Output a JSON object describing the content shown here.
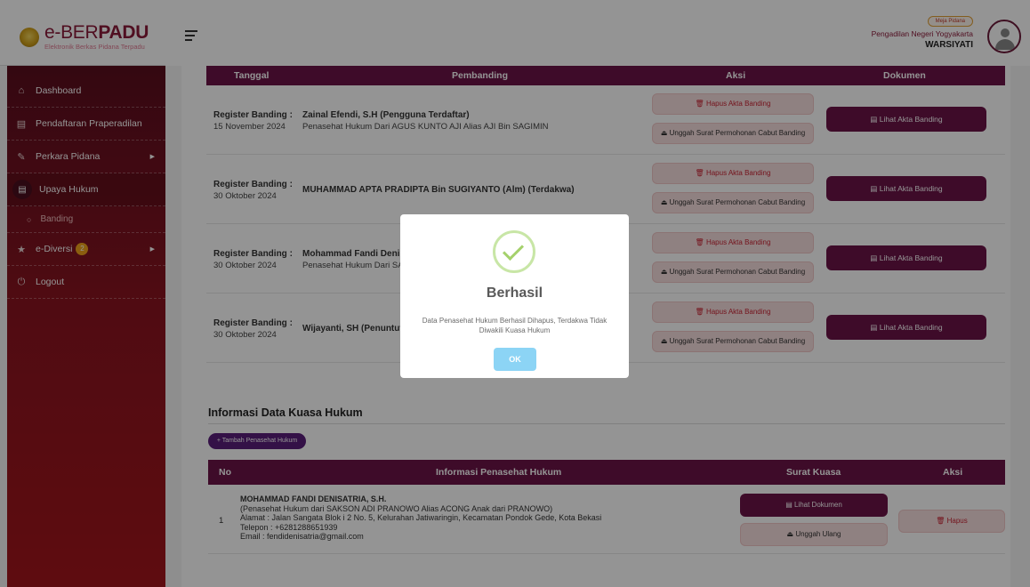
{
  "brand": {
    "title_prefix": "e-BER",
    "title_bold": "PADU",
    "subtitle": "Elektronik Berkas Pidana Terpadu"
  },
  "header": {
    "meja_badge": "Meja Pidana",
    "court": "Pengadilan Negeri Yogyakarta",
    "user": "WARSIYATI"
  },
  "sidebar": {
    "items": [
      {
        "label": "Dashboard",
        "icon": "home-icon"
      },
      {
        "label": "Pendaftaran Praperadilan",
        "icon": "document-icon"
      },
      {
        "label": "Perkara Pidana",
        "icon": "edit-icon"
      },
      {
        "label": "Upaya Hukum",
        "icon": "document-icon"
      },
      {
        "label": "Banding",
        "icon": "circle-icon"
      },
      {
        "label": "e-Diversi",
        "icon": "star-icon",
        "badge": "2"
      },
      {
        "label": "Logout",
        "icon": "power-icon"
      }
    ]
  },
  "banding_table": {
    "headers": [
      "Tanggal",
      "Pembanding",
      "Aksi",
      "Dokumen"
    ],
    "rows": [
      {
        "reg_label": "Register Banding :",
        "date": "15 November 2024",
        "name": "Zainal Efendi, S.H (Pengguna Terdaftar)",
        "sub": "Penasehat Hukum Dari AGUS KUNTO AJI Alias AJI Bin SAGIMIN"
      },
      {
        "reg_label": "Register Banding :",
        "date": "30 Oktober 2024",
        "name": "MUHAMMAD APTA PRADIPTA Bin SUGIYANTO (Alm) (Terdakwa)",
        "sub": ""
      },
      {
        "reg_label": "Register Banding :",
        "date": "30 Oktober 2024",
        "name": "Mohammad Fandi Denisa",
        "sub": "Penasehat Hukum Dari SAK"
      },
      {
        "reg_label": "Register Banding :",
        "date": "30 Oktober 2024",
        "name": "Wijayanti, SH (Penuntut U",
        "sub": ""
      }
    ],
    "btn_hapus_akta": "Hapus Akta Banding",
    "btn_unggah": "Unggah Surat Permohonan Cabut Banding",
    "btn_lihat_akta": "Lihat Akta Banding"
  },
  "kuasa": {
    "title": "Informasi Data Kuasa Hukum",
    "add_button": "+ Tambah Penasehat Hukum",
    "headers": [
      "No",
      "Informasi Penasehat Hukum",
      "Surat Kuasa",
      "Aksi"
    ],
    "row": {
      "no": "1",
      "lines": [
        "MOHAMMAD FANDI DENISATRIA, S.H.",
        "(Penasehat Hukum dari SAKSON ADI PRANOWO Alias ACONG Anak dari PRANOWO)",
        "Alamat : Jalan Sangata Blok i 2 No. 5, Kelurahan Jatiwaringin, Kecamatan Pondok Gede, Kota Bekasi",
        "Telepon : +6281288651939",
        "Email : fendidenisatria@gmail.com"
      ],
      "btn_lihat": "Lihat Dokumen",
      "btn_unggah": "Unggah Ulang",
      "btn_hapus": "Hapus"
    }
  },
  "modal": {
    "title": "Berhasil",
    "text": "Data Penasehat Hukum Berhasil Dihapus, Terdakwa Tidak Diwakili Kuasa Hukum",
    "ok": "OK"
  },
  "colors": {
    "primary": "#6b1347",
    "sidebar": "#8a1420",
    "success": "#a5d16c",
    "ok_button": "#8cd4f5"
  }
}
